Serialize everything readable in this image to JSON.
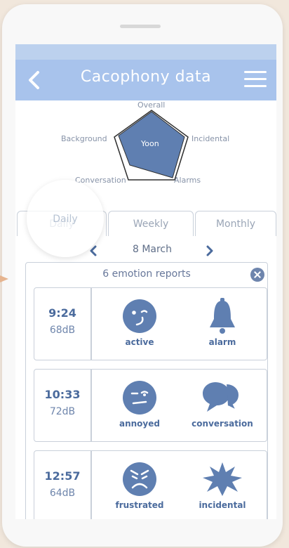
{
  "header": {
    "title": "Cacophony data"
  },
  "radar": {
    "labels": {
      "overall": "Overall",
      "incidental": "Incidental",
      "alarms": "Alarms",
      "conversation": "Conversation",
      "background": "Background"
    },
    "center_label": "Yoon",
    "fill_color": "#5f7fb1"
  },
  "tabs": [
    {
      "label": "Daily"
    },
    {
      "label": "Weekly"
    },
    {
      "label": "Monthly"
    }
  ],
  "date": "8 March",
  "reports": {
    "title": "6 emotion reports",
    "items": [
      {
        "time": "9:24",
        "db": "68dB",
        "emotion": "active",
        "emotion_icon": "smile-face-icon",
        "source": "alarm",
        "source_icon": "bell-icon"
      },
      {
        "time": "10:33",
        "db": "72dB",
        "emotion": "annoyed",
        "emotion_icon": "annoyed-face-icon",
        "source": "conversation",
        "source_icon": "speech-bubbles-icon"
      },
      {
        "time": "12:57",
        "db": "64dB",
        "emotion": "frustrated",
        "emotion_icon": "frustrated-face-icon",
        "source": "incidental",
        "source_icon": "burst-icon"
      }
    ]
  },
  "colors": {
    "header_bg": "#a8c3ec",
    "icon": "#5f7fb1",
    "accent_text": "#4b6b9d",
    "page_bg": "#f1e7dc"
  }
}
